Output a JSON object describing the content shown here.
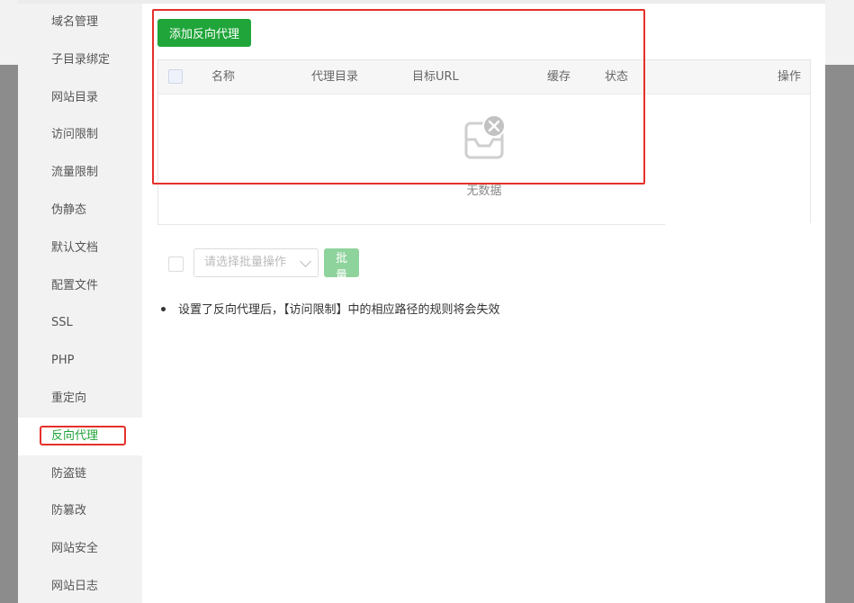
{
  "sidebar": {
    "items": [
      {
        "label": "域名管理"
      },
      {
        "label": "子目录绑定"
      },
      {
        "label": "网站目录"
      },
      {
        "label": "访问限制"
      },
      {
        "label": "流量限制"
      },
      {
        "label": "伪静态"
      },
      {
        "label": "默认文档"
      },
      {
        "label": "配置文件"
      },
      {
        "label": "SSL"
      },
      {
        "label": "PHP"
      },
      {
        "label": "重定向"
      },
      {
        "label": "反向代理"
      },
      {
        "label": "防盗链"
      },
      {
        "label": "防篡改"
      },
      {
        "label": "网站安全"
      },
      {
        "label": "网站日志"
      }
    ],
    "active": "反向代理"
  },
  "toolbar": {
    "add_label": "添加反向代理"
  },
  "table": {
    "columns": [
      "名称",
      "代理目录",
      "目标URL",
      "缓存",
      "状态",
      "操作"
    ],
    "rows": [],
    "empty_text": "无数据"
  },
  "batch": {
    "select_placeholder": "请选择批量操作",
    "button_label": "批量操作"
  },
  "notes": [
    "设置了反向代理后，【访问限制】中的相应路径的规则将会失效"
  ],
  "colors": {
    "accent": "#20a53a",
    "highlight": "#e5302b"
  }
}
